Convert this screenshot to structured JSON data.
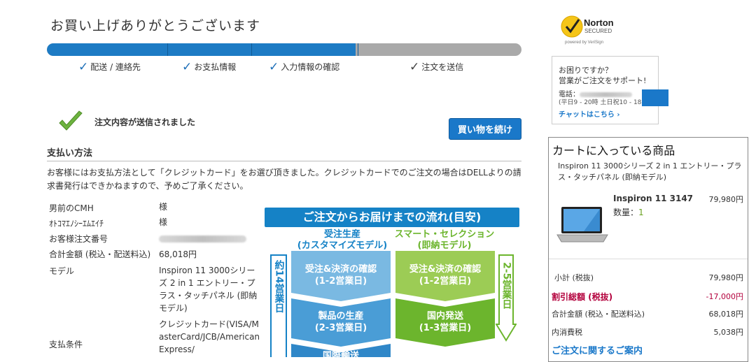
{
  "page": {
    "title": "お買い上げありがとうございます"
  },
  "progress": {
    "completed_fraction": 0.65,
    "steps": [
      {
        "label": "配送 / 連絡先",
        "done": true
      },
      {
        "label": "お支払情報",
        "done": true
      },
      {
        "label": "入力情報の確認",
        "done": true
      },
      {
        "label": "注文を送信",
        "done": false
      }
    ]
  },
  "confirmation": {
    "message": "注文内容が送信されました",
    "continue_label": "買い物を続ける"
  },
  "payment": {
    "heading": "支払い方法",
    "description": "お客様にはお支払方法として「クレジットカード」をお選び頂きました。クレジットカードでのご注文の場合はDELLよりの請求書発行はできかねますので、予めご了承ください。"
  },
  "details": {
    "name_label": "男前のCMH",
    "name_value": "様",
    "kana_label": "ｵﾄｺﾏｴﾉｼｰｴﾑｴｲﾁ",
    "kana_value": "様",
    "order_label": "お客様注文番号",
    "total_label": "合計金額 (税込・配送料込)",
    "total_value": "68,018円",
    "model_label": "モデル",
    "model_value": "Inspiron 11 3000シリーズ 2 in 1 エントリー・プラス・タッチパネル (即納モデル)",
    "terms_label": "支払条件",
    "terms_value": "クレジットカード(VISA/MasterCard/JCB/AmericanExpress/"
  },
  "flow": {
    "banner": "ご注文からお届けまでの流れ(目安)",
    "left_header_1": "受注生産",
    "left_header_2": "(カスタマイズモデル)",
    "right_header_1": "スマート・セレクション",
    "right_header_2": "(即納モデル)",
    "left_side": "約14営業日",
    "right_side": "2-5営業日",
    "left_box1_1": "受注&決済の確認",
    "left_box1_2": "(1-2営業日)",
    "left_box2_1": "製品の生産",
    "left_box2_2": "(2-3営業日)",
    "left_box3_1": "国際輸送",
    "right_box1_1": "受注&決済の確認",
    "right_box1_2": "(1-2営業日)",
    "right_box2_1": "国内発送",
    "right_box2_2": "(1-3営業日)",
    "colors": {
      "blue": "#1582c6",
      "light_blue": "#7ab9e2",
      "mid_blue": "#4a9dd6",
      "green": "#6cb52d",
      "light_green": "#9ccc55"
    }
  },
  "norton": {
    "brand": "Norton",
    "secured": "SECURED",
    "powered": "powered by VeriSign"
  },
  "support": {
    "line1": "お困りですか？",
    "line2": "営業がご注文をサポート!",
    "phone_label": "電話：",
    "hours": "(平日9 - 20時 土日祝10 - 18時)",
    "chat": "チャットはこちら ›"
  },
  "cart": {
    "title": "カートに入っている商品",
    "product_name": "Inspiron 11 3000シリーズ 2 in 1 エントリー・プラス・タッチパネル (即納モデル)",
    "model": "Inspiron 11 3147",
    "price": "79,980円",
    "qty_label": "数量：",
    "qty": "1",
    "subtotal_label": "小計 (税抜)",
    "subtotal": "79,980円",
    "discount_label": "割引総額 (税抜)",
    "discount": "-17,000円",
    "total_label": "合計金額 (税込・配送料込)",
    "total": "68,018円",
    "tax_label": "内消費税",
    "tax": "5,038円",
    "guide": "ご注文に関するご案内"
  }
}
